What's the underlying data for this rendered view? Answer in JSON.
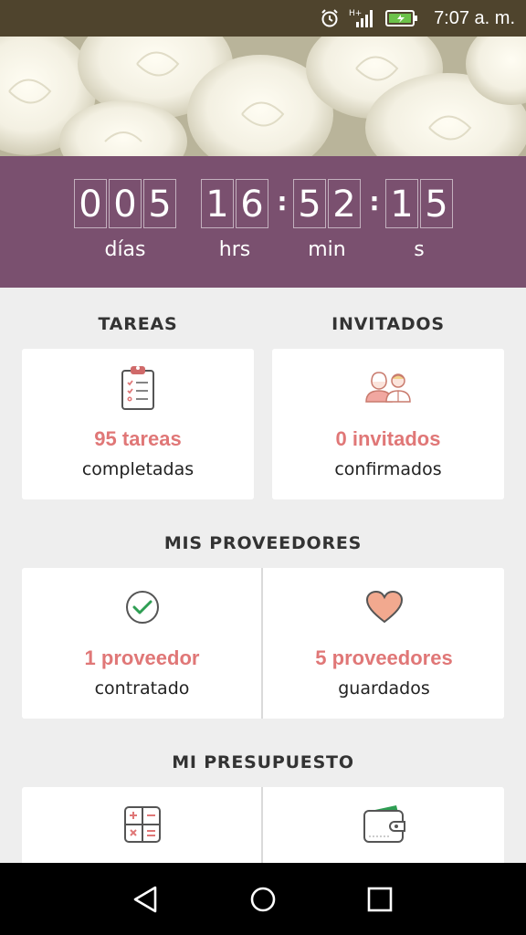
{
  "status_bar": {
    "time": "7:07 a. m."
  },
  "countdown": {
    "days_digits": [
      "0",
      "0",
      "5"
    ],
    "hours_digits": [
      "1",
      "6"
    ],
    "minutes_digits": [
      "5",
      "2"
    ],
    "seconds_digits": [
      "1",
      "5"
    ],
    "labels": {
      "days": "días",
      "hours": "hrs",
      "minutes": "min",
      "seconds": "s"
    }
  },
  "tareas": {
    "title": "TAREAS",
    "count": "95 tareas",
    "sub": "completadas",
    "icon": "clipboard-checklist-icon"
  },
  "invitados": {
    "title": "INVITADOS",
    "count": "0 invitados",
    "sub": "confirmados",
    "icon": "guests-couple-icon"
  },
  "proveedores": {
    "title": "MIS PROVEEDORES",
    "contratado": {
      "count": "1 proveedor",
      "sub": "contratado",
      "icon": "check-circle-icon"
    },
    "guardados": {
      "count": "5 proveedores",
      "sub": "guardados",
      "icon": "heart-icon"
    }
  },
  "presupuesto": {
    "title": "MI PRESUPUESTO",
    "left_icon": "calculator-icon",
    "right_icon": "wallet-icon"
  },
  "colors": {
    "accent": "#7a506f",
    "highlight": "#e07777",
    "check": "#2e9e53",
    "heart": "#f2a98f"
  }
}
